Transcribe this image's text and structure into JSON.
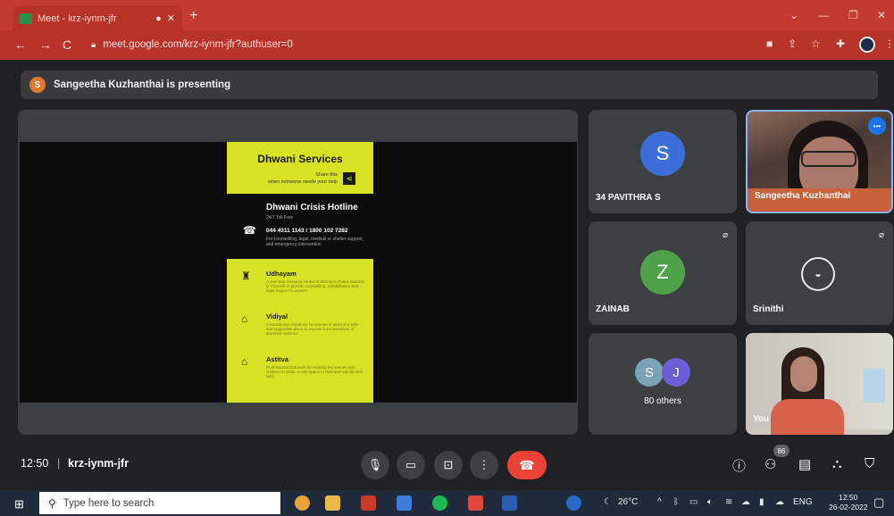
{
  "browser": {
    "tab_title": "Meet - krz-iynm-jfr",
    "tab_audio_icon": "speaker-icon",
    "tab_close": "✕",
    "new_tab": "+",
    "url": "meet.google.com/krz-iynm-jfr?authuser=0",
    "colors": {
      "tab_bar": "#c43a2e",
      "toolbar": "#b8342a"
    }
  },
  "meet": {
    "presenting_initial": "S",
    "presenting_text": "Sangeetha Kuzhanthai is presenting",
    "slide": {
      "header_title": "Dhwani Services",
      "header_line1": "Share this",
      "header_line2": "when someone needs your help",
      "hotline_title": "Dhwani Crisis Hotline",
      "hotline_sub": "24/7 Toll Free",
      "hotline_numbers": "044 4311 1143 / 1800 102 7282",
      "hotline_desc": "For counselling, legal, medical or shelter support, and emergency intervention",
      "items": [
        {
          "name": "Udhayam",
          "desc": "A one-stop resource centre at Women's Police Stations in Chennai to provide counselling, rehabilitation and legal support to women"
        },
        {
          "name": "Vidiyal",
          "desc": "A transitional residence for women in need of a safe and supportive place to recover from situations of domestic violence"
        },
        {
          "name": "Astitva",
          "desc": "Professional Outreach for Healing the women and children in crisis. A safe space to heal and rebuild their lives"
        }
      ]
    },
    "participants": [
      {
        "name": "34 PAVITHRA S",
        "initial": "S",
        "color": "#3e6ed8"
      },
      {
        "name": "Sangeetha Kuzhanthai"
      },
      {
        "name": "ZAINAB",
        "initial": "Z",
        "color": "#4fa14a"
      },
      {
        "name": "Srinithi"
      },
      {
        "name": "80 others",
        "initials": [
          "S",
          "J"
        ],
        "colors": [
          "#7aa3b5",
          "#6b5fd8"
        ]
      },
      {
        "name": "You"
      }
    ],
    "controls": {
      "time": "12:50",
      "separator": "|",
      "meeting_code": "krz-iynm-jfr",
      "participant_count": "86"
    },
    "colors": {
      "background": "#202124",
      "tile": "#3c4043",
      "end_call": "#ea4335",
      "poster_yellow": "#d8e224"
    }
  },
  "taskbar": {
    "search_placeholder": "Type here to search",
    "weather": "26°C",
    "language": "ENG",
    "time": "12:50",
    "date": "26-02-2022"
  }
}
